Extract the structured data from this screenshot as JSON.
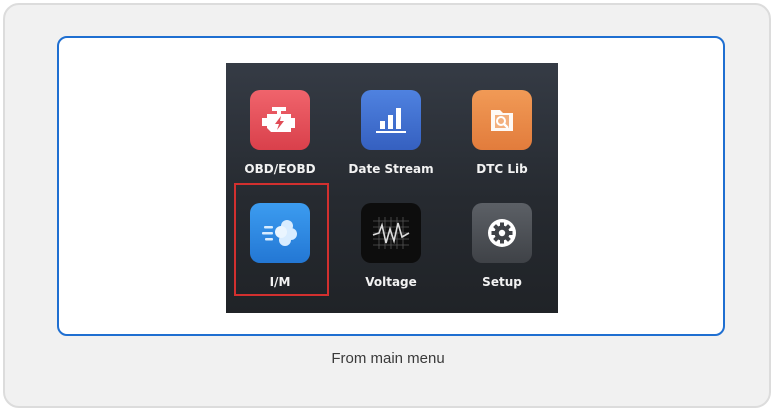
{
  "menu": {
    "items": [
      {
        "label": "OBD/EOBD",
        "icon": "engine-icon",
        "color": "#e8505b"
      },
      {
        "label": "Date Stream",
        "icon": "bar-chart-icon",
        "color": "#3d6fd0"
      },
      {
        "label": "DTC Lib",
        "icon": "search-document-icon",
        "color": "#e88b47"
      },
      {
        "label": "I/M",
        "icon": "exhaust-cloud-icon",
        "color": "#2f8de4"
      },
      {
        "label": "Voltage",
        "icon": "waveform-icon",
        "color": "#111111"
      },
      {
        "label": "Setup",
        "icon": "gear-icon",
        "color": "#4a4d52"
      }
    ],
    "selected_item": "I/M",
    "selection_color": "#d2302f"
  },
  "caption": "From main menu",
  "colors": {
    "frame_accent": "#1f6fd1",
    "card_background": "#f1f1f1"
  }
}
